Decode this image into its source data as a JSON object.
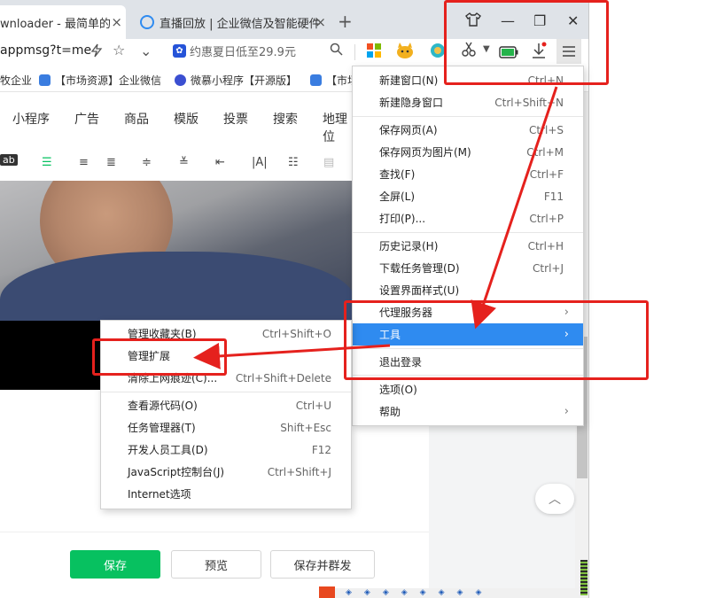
{
  "tabs": [
    {
      "label": "wnloader - 最简单的",
      "close": "×"
    },
    {
      "label": "直播回放 | 企业微信及智能硬件",
      "close": "×"
    }
  ],
  "new_tab": "+",
  "address": {
    "url": "appmsg?t=me",
    "promo": "约惠夏日低至29.9元",
    "promo_icon": "paw-icon"
  },
  "window_controls": {
    "minimize": "—",
    "restore": "❐",
    "close": "✕"
  },
  "bookmarks": [
    {
      "label": "牧企业"
    },
    {
      "label": "【市场资源】企业微信"
    },
    {
      "label": "微慕小程序【开源版】"
    },
    {
      "label": "【市场"
    }
  ],
  "page_nav": [
    "小程序",
    "广告",
    "商品",
    "模版",
    "投票",
    "搜索",
    "地理位"
  ],
  "editor_toolbar": {
    "ab_label": "ab"
  },
  "main_menu": {
    "items": [
      {
        "label": "新建窗口(N)",
        "shortcut": "Ctrl+N"
      },
      {
        "label": "新建隐身窗口",
        "shortcut": "Ctrl+Shift+N"
      },
      {
        "label": "保存网页(A)",
        "shortcut": "Ctrl+S"
      },
      {
        "label": "保存网页为图片(M)",
        "shortcut": "Ctrl+M"
      },
      {
        "label": "查找(F)",
        "shortcut": "Ctrl+F"
      },
      {
        "label": "全屏(L)",
        "shortcut": "F11"
      },
      {
        "label": "打印(P)...",
        "shortcut": "Ctrl+P"
      },
      {
        "label": "历史记录(H)",
        "shortcut": "Ctrl+H"
      },
      {
        "label": "下载任务管理(D)",
        "shortcut": "Ctrl+J"
      },
      {
        "label": "设置界面样式(U)",
        "shortcut": ""
      },
      {
        "label": "代理服务器",
        "shortcut": ""
      },
      {
        "label": "工具",
        "shortcut": ""
      },
      {
        "label": "退出登录",
        "shortcut": ""
      },
      {
        "label": "选项(O)",
        "shortcut": ""
      },
      {
        "label": "帮助",
        "shortcut": ""
      }
    ],
    "submenu_arrow": "›"
  },
  "tools_menu": {
    "items": [
      {
        "label": "管理收藏夹(B)",
        "shortcut": "Ctrl+Shift+O"
      },
      {
        "label": "管理扩展",
        "shortcut": ""
      },
      {
        "label": "清除上网痕迹(C)...",
        "shortcut": "Ctrl+Shift+Delete"
      },
      {
        "label": "查看源代码(O)",
        "shortcut": "Ctrl+U"
      },
      {
        "label": "任务管理器(T)",
        "shortcut": "Shift+Esc"
      },
      {
        "label": "开发人员工具(D)",
        "shortcut": "F12"
      },
      {
        "label": "JavaScript控制台(J)",
        "shortcut": "Ctrl+Shift+J"
      },
      {
        "label": "Internet选项",
        "shortcut": ""
      }
    ]
  },
  "buttons": {
    "save": "保存",
    "preview": "预览",
    "save_send": "保存并群发"
  },
  "colors": {
    "annotation": "#e5211d",
    "highlight": "#2f8bf0",
    "primary": "#07c160"
  }
}
